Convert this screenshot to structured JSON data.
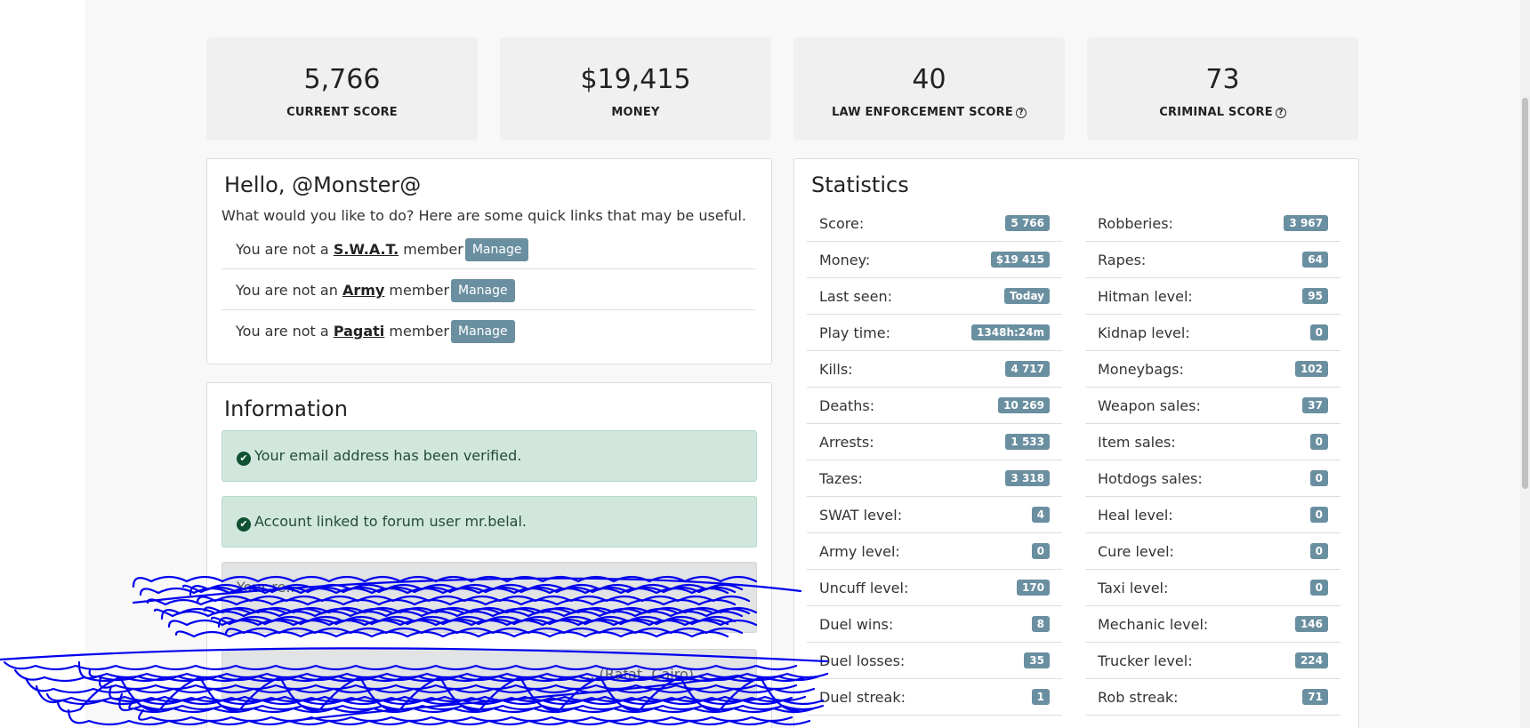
{
  "score_cards": [
    {
      "value": "5,766",
      "label": "CURRENT SCORE"
    },
    {
      "value": "$19,415",
      "label": "MONEY"
    },
    {
      "value": "40",
      "label": "LAW ENFORCEMENT SCORE"
    },
    {
      "value": "73",
      "label": "CRIMINAL SCORE"
    }
  ],
  "welcome": {
    "title": "Hello, @Monster@",
    "intro": "What would you like to do? Here are some quick links that may be useful.",
    "manage_label": "Manage",
    "memberships": [
      {
        "prefix": "You are not a",
        "org": "S.W.A.T.",
        "suffix": "member"
      },
      {
        "prefix": "You are not an",
        "org": "Army",
        "suffix": "member"
      },
      {
        "prefix": "You are not a",
        "org": "Pagati",
        "suffix": "member"
      }
    ]
  },
  "information": {
    "title": "Information",
    "alerts": [
      {
        "text": "Your email address has been verified."
      },
      {
        "text": "Account linked to forum user mr.belal."
      }
    ],
    "obscured_alerts": [
      {
        "text": "Your re..."
      },
      {
        "text": "...(Rafat, Cairo)"
      }
    ]
  },
  "statistics": {
    "title": "Statistics",
    "left": [
      {
        "label": "Score:",
        "value": "5 766"
      },
      {
        "label": "Money:",
        "value": "$19 415"
      },
      {
        "label": "Last seen:",
        "value": "Today"
      },
      {
        "label": "Play time:",
        "value": "1348h:24m"
      },
      {
        "label": "Kills:",
        "value": "4 717"
      },
      {
        "label": "Deaths:",
        "value": "10 269"
      },
      {
        "label": "Arrests:",
        "value": "1 533"
      },
      {
        "label": "Tazes:",
        "value": "3 318"
      },
      {
        "label": "SWAT level:",
        "value": "4"
      },
      {
        "label": "Army level:",
        "value": "0"
      },
      {
        "label": "Uncuff level:",
        "value": "170"
      },
      {
        "label": "Duel wins:",
        "value": "8"
      },
      {
        "label": "Duel losses:",
        "value": "35"
      },
      {
        "label": "Duel streak:",
        "value": "1"
      }
    ],
    "right": [
      {
        "label": "Robberies:",
        "value": "3 967"
      },
      {
        "label": "Rapes:",
        "value": "64"
      },
      {
        "label": "Hitman level:",
        "value": "95"
      },
      {
        "label": "Kidnap level:",
        "value": "0"
      },
      {
        "label": "Moneybags:",
        "value": "102"
      },
      {
        "label": "Weapon sales:",
        "value": "37"
      },
      {
        "label": "Item sales:",
        "value": "0"
      },
      {
        "label": "Hotdogs sales:",
        "value": "0"
      },
      {
        "label": "Heal level:",
        "value": "0"
      },
      {
        "label": "Cure level:",
        "value": "0"
      },
      {
        "label": "Taxi level:",
        "value": "0"
      },
      {
        "label": "Mechanic level:",
        "value": "146"
      },
      {
        "label": "Trucker level:",
        "value": "224"
      },
      {
        "label": "Rob streak:",
        "value": "71"
      }
    ]
  },
  "colors": {
    "badge": "#6a8fa0",
    "scribble": "#0000ee",
    "success_bg": "#d1e7dd"
  }
}
